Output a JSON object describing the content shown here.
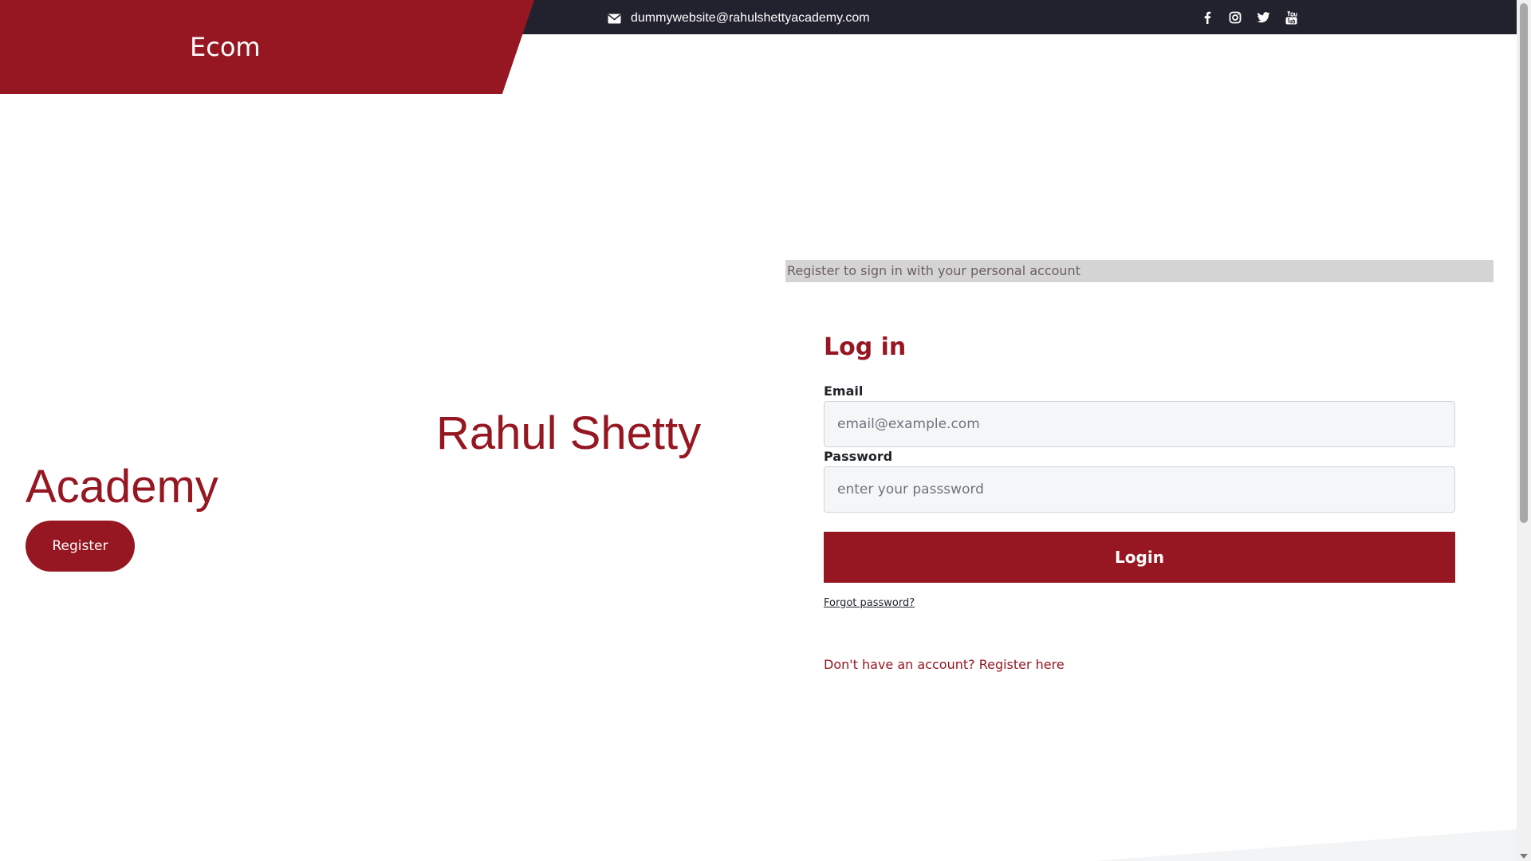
{
  "header": {
    "brand": "Ecom",
    "contact_email": "dummywebsite@rahulshettyacademy.com",
    "social_icons": [
      "facebook-icon",
      "instagram-icon",
      "twitter-icon",
      "youtube-icon"
    ]
  },
  "hero": {
    "line1": "Rahul Shetty",
    "line2": "Academy",
    "register_label": "Register"
  },
  "login": {
    "banner": "Register to sign in with your personal account",
    "title": "Log in",
    "email_label": "Email",
    "email_placeholder": "email@example.com",
    "email_value": "",
    "password_label": "Password",
    "password_placeholder": "enter your passsword",
    "password_value": "",
    "submit_label": "Login",
    "forgot_label": "Forgot password?",
    "signup_label": "Don't have an account? Register here"
  },
  "colors": {
    "brand": "#961721",
    "topbar": "#22222f",
    "banner_bg": "#d4d4d4"
  }
}
